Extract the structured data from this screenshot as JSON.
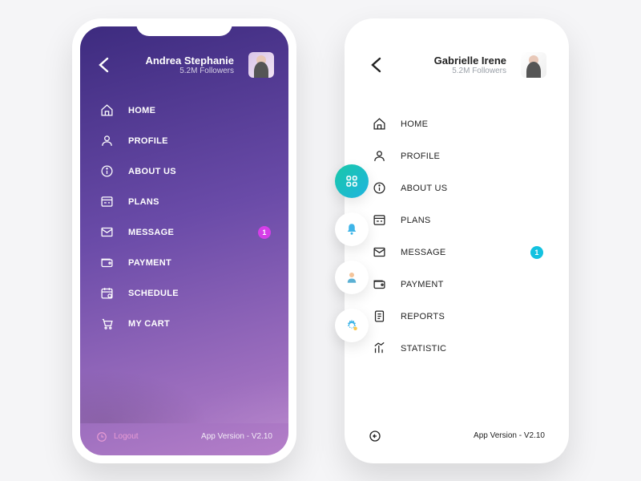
{
  "left": {
    "user": {
      "name": "Andrea Stephanie",
      "followers": "5.2M Followers"
    },
    "menu": [
      {
        "icon": "home",
        "label": "HOME"
      },
      {
        "icon": "profile",
        "label": "PROFILE"
      },
      {
        "icon": "info",
        "label": "ABOUT US"
      },
      {
        "icon": "plans",
        "label": "PLANS"
      },
      {
        "icon": "message",
        "label": "MESSAGE",
        "badge": "1"
      },
      {
        "icon": "payment",
        "label": "PAYMENT"
      },
      {
        "icon": "schedule",
        "label": "SCHEDULE"
      },
      {
        "icon": "cart",
        "label": "MY CART"
      }
    ],
    "logout": "Logout",
    "version": "App Version - V2.10"
  },
  "right": {
    "user": {
      "name": "Gabrielle Irene",
      "followers": "5.2M Followers"
    },
    "menu": [
      {
        "icon": "home",
        "label": "HOME"
      },
      {
        "icon": "profile",
        "label": "PROFILE"
      },
      {
        "icon": "info",
        "label": "ABOUT US"
      },
      {
        "icon": "plans",
        "label": "PLANS"
      },
      {
        "icon": "message",
        "label": "MESSAGE",
        "badge": "1"
      },
      {
        "icon": "payment",
        "label": "PAYMENT"
      },
      {
        "icon": "reports",
        "label": "REPORTS"
      },
      {
        "icon": "statistic",
        "label": "STATISTIC"
      }
    ],
    "version": "App Version - V2.10",
    "sideIcons": [
      "apps",
      "bell",
      "user",
      "gear"
    ]
  },
  "colors": {
    "purpleTop": "#3d2b7f",
    "purpleBottom": "#b57fc9",
    "cyan": "#13c2e0",
    "magenta": "#d63ee8"
  }
}
